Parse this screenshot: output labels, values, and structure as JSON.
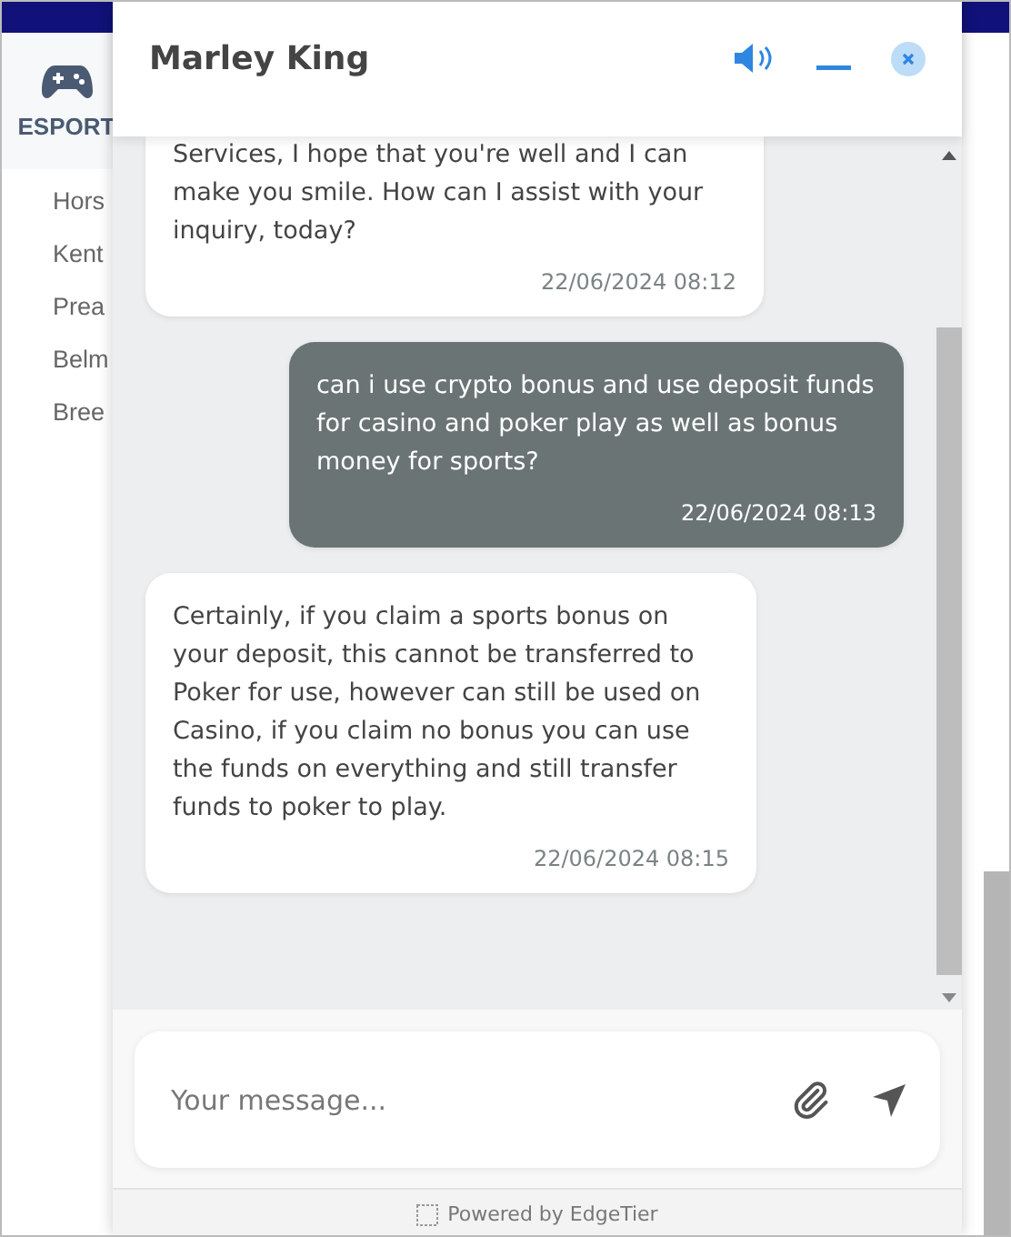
{
  "background": {
    "section": "ESPORT",
    "links": [
      "Hors",
      "Kent",
      "Prea",
      "Belm",
      "Bree"
    ]
  },
  "chat": {
    "agent_name": "Marley King",
    "messages": [
      {
        "kind": "agent",
        "text": "Services, I hope that you're well and I can make you smile. How can I assist with your inquiry, today?",
        "time": "22/06/2024 08:12"
      },
      {
        "kind": "user",
        "text": "can i use crypto bonus and use deposit funds for casino and poker play as well as bonus money for sports?",
        "time": "22/06/2024 08:13"
      },
      {
        "kind": "agent",
        "text": "Certainly, if you claim a sports bonus on your deposit, this cannot be transferred to Poker for use, however can still be used on Casino, if you claim no bonus you can use the funds on everything and still transfer funds to poker to play.",
        "time": "22/06/2024 08:15"
      }
    ],
    "composer": {
      "placeholder": "Your message..."
    },
    "footer": "Powered by EdgeTier"
  }
}
